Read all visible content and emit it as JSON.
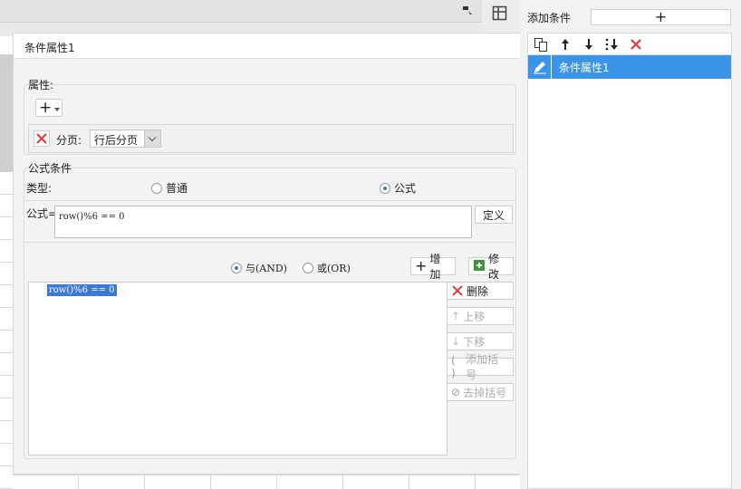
{
  "dialog": {
    "title": "条件属性1"
  },
  "attributes": {
    "section_label": "属性:",
    "add_symbol": "+",
    "page_label": "分页:",
    "page_value": "行后分页"
  },
  "formula_condition": {
    "section_label": "公式条件",
    "type_label": "类型:",
    "type_normal": "普通",
    "type_formula": "公式",
    "formula_label": "公式=",
    "formula_value": "row()%6 == 0",
    "define_button": "定义",
    "and_label": "与(AND)",
    "or_label": "或(OR)",
    "add_button": "增加",
    "modify_button": "修改",
    "delete_button": "删除",
    "move_up_button": "上移",
    "move_down_button": "下移",
    "add_bracket_button": "添加括号",
    "remove_bracket_button": "去掉括号",
    "conditions": [
      "row()%6 == 0"
    ]
  },
  "right_panel": {
    "title": "添加条件",
    "add_symbol": "+",
    "items": [
      "条件属性1"
    ]
  },
  "colors": {
    "selection": "#3b94e8",
    "delete_red": "#e03a3a"
  }
}
